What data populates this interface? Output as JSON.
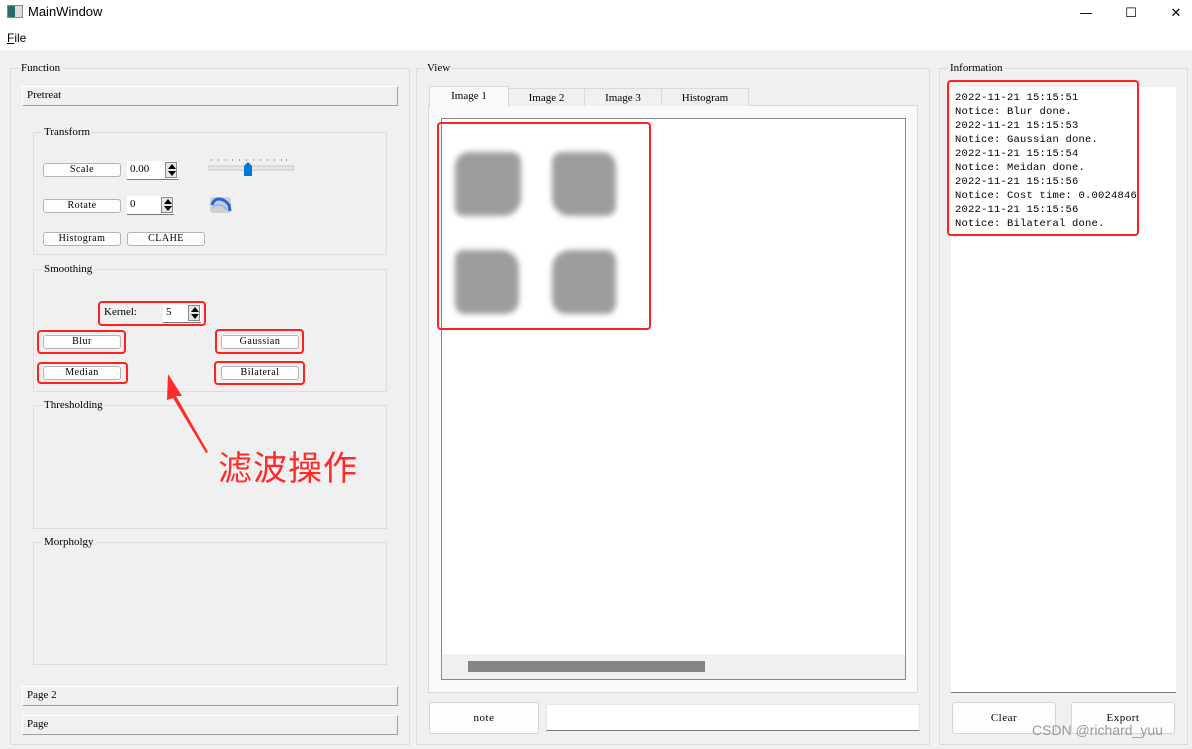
{
  "window": {
    "title": "MainWindow",
    "minimize_icon": "—",
    "maximize_icon": "☐",
    "close_icon": "✕"
  },
  "menubar": {
    "items": [
      {
        "mnemonic": "F",
        "rest": "ile",
        "label": "File"
      }
    ]
  },
  "function_panel": {
    "title": "Function",
    "pretreat_label": "Pretreat",
    "transform": {
      "title": "Transform",
      "scale_button": "Scale",
      "scale_value": "0.00",
      "scale_slider_fraction": 0.45,
      "rotate_button": "Rotate",
      "rotate_value": "0",
      "histogram_button": "Histogram",
      "clahe_button": "CLAHE"
    },
    "smoothing": {
      "title": "Smoothing",
      "kernel_label": "Kernel:",
      "kernel_value": "5",
      "blur_button": "Blur",
      "gaussian_button": "Gaussian",
      "median_button": "Median",
      "bilateral_button": "Bilateral"
    },
    "thresholding": {
      "title": "Thresholding"
    },
    "morphology": {
      "title": "Morpholgy"
    },
    "page2_label": "Page 2",
    "page_label": "Page"
  },
  "view_panel": {
    "title": "View",
    "tabs": [
      {
        "label": "Image 1",
        "active": true
      },
      {
        "label": "Image 2",
        "active": false
      },
      {
        "label": "Image 3",
        "active": false
      },
      {
        "label": "Histogram",
        "active": false
      }
    ],
    "note_button": "note",
    "note_input_value": ""
  },
  "information_panel": {
    "title": "Information",
    "log": [
      "2022-11-21 15:15:51",
      "Notice: Blur done.",
      "2022-11-21 15:15:53",
      "Notice: Gaussian done.",
      "2022-11-21 15:15:54",
      "Notice: Meidan done.",
      "2022-11-21 15:15:56",
      "Notice: Cost time: 0.0024846",
      "2022-11-21 15:15:56",
      "Notice: Bilateral done."
    ],
    "clear_button": "Clear",
    "export_button": "Export"
  },
  "annotation": {
    "text": "滤波操作",
    "color": "#ff2a2a"
  },
  "watermark": "CSDN @richard_yuu"
}
